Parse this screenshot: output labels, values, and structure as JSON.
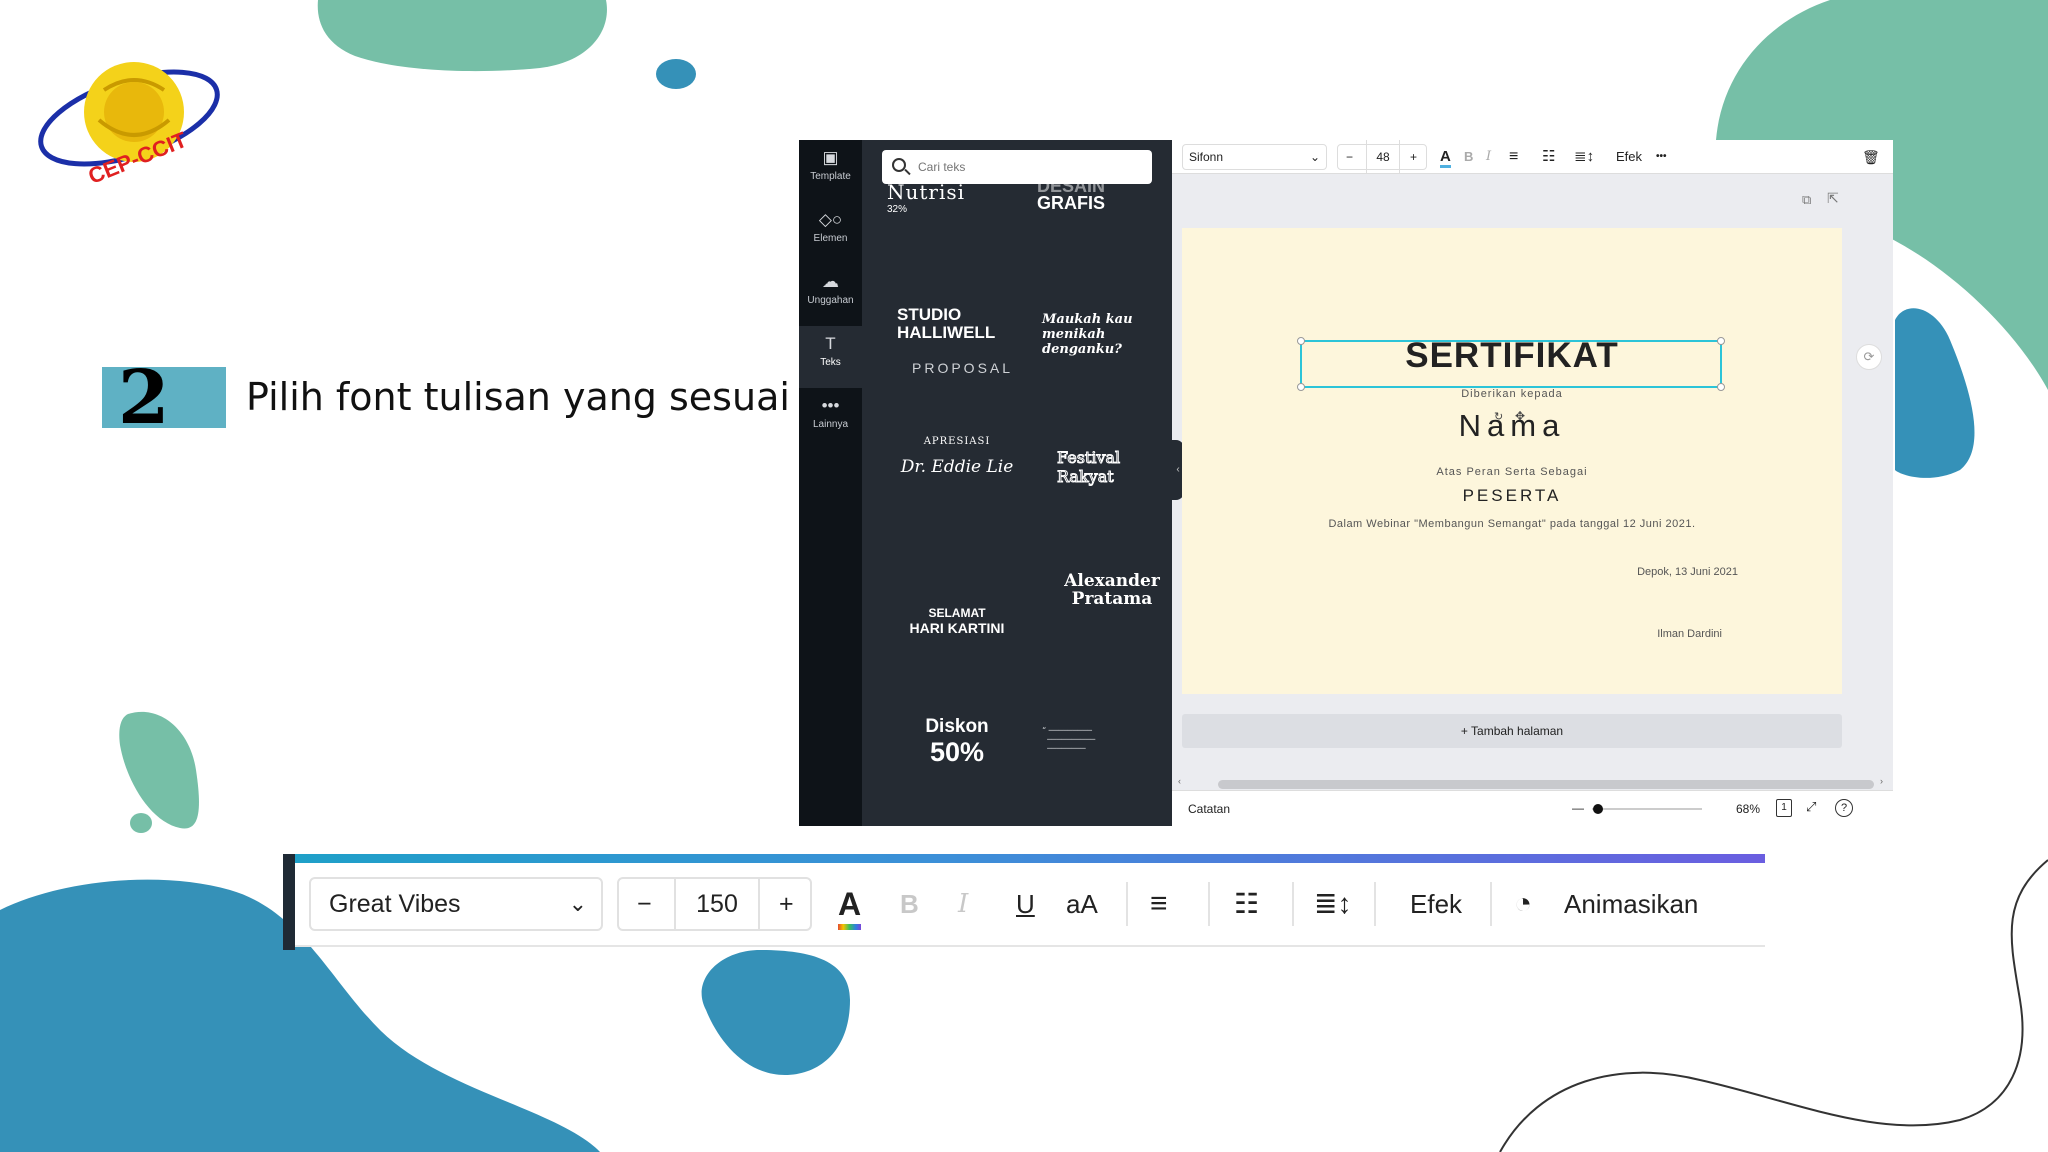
{
  "logo": {
    "text": "CEP-CCIT"
  },
  "step": {
    "number": "2",
    "text": "Pilih font tulisan yang sesuai"
  },
  "rail": {
    "items": [
      {
        "label": "Template",
        "icon": "template-icon"
      },
      {
        "label": "Elemen",
        "icon": "shapes-icon"
      },
      {
        "label": "Unggahan",
        "icon": "cloud-upload-icon"
      },
      {
        "label": "Teks",
        "icon": "text-icon"
      },
      {
        "label": "Lainnya",
        "icon": "more-icon"
      }
    ]
  },
  "panel": {
    "search_placeholder": "Cari teks",
    "tiles": {
      "nutrisi_title": "Nutrisi",
      "nutrisi_pct": "32%",
      "desain": "DESAIN",
      "grafis": "GRAFIS",
      "studio_line1": "STUDIO",
      "studio_line2": "HALLIWELL",
      "proposal": "PROPOSAL",
      "maukah_line1": "Maukah kau",
      "maukah_line2": "menikah denganku?",
      "apresiasi": "APRESIASI",
      "eddie": "Dr. Eddie Lie",
      "festival_line1": "Festival",
      "festival_line2": "Rakyat",
      "selamat_line1": "SELAMAT",
      "selamat_line2": "HARI KARTINI",
      "alexander_line1": "Alexander",
      "alexander_line2": "Pratama",
      "diskon": "Diskon",
      "diskon_pct": "50%"
    }
  },
  "toolbar": {
    "font": "Sifonn",
    "size": "48",
    "minus": "−",
    "plus": "+",
    "bold": "B",
    "italic": "I",
    "effects": "Efek",
    "more": "•••"
  },
  "certificate": {
    "title": "SERTIFIKAT",
    "given_to": "Diberikan kepada",
    "name": "Nama",
    "role_intro": "Atas Peran Serta Sebagai",
    "role": "PESERTA",
    "event": "Dalam Webinar \"Membangun Semangat\" pada tanggal 12 Juni 2021.",
    "place_date": "Depok, 13 Juni 2021",
    "signer": "Ilman Dardini"
  },
  "add_page": "+ Tambah halaman",
  "footer": {
    "notes": "Catatan",
    "zoom": "68%",
    "zoom_level": 0.68,
    "page_count": "1",
    "help": "?"
  },
  "zoom_toolbar": {
    "font": "Great Vibes",
    "minus": "−",
    "size": "150",
    "plus": "+",
    "bold": "B",
    "italic": "I",
    "underline": "U",
    "case": "aA",
    "effects": "Efek",
    "animate": "Animasikan"
  },
  "colors": {
    "teal_blob": "#76bfa7",
    "blue_blob": "#3591b8",
    "step_box": "#5fb1c4",
    "selection": "#2cc4d8",
    "page_bg": "#fdf6dc",
    "panel_bg": "#252b33",
    "rail_bg": "#0e1318"
  }
}
